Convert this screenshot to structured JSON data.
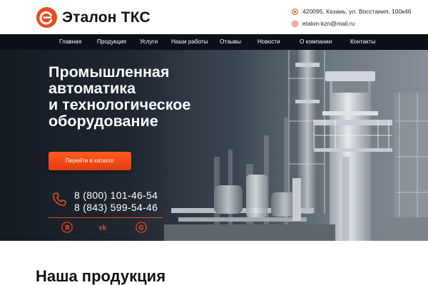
{
  "header": {
    "brand": "Эталон ТКС",
    "address": "420095, Казань, ул. Восстания, 100к46",
    "email": "etalon-kzn@mail.ru",
    "accent_color": "#e94a1c"
  },
  "nav": {
    "items": [
      {
        "label": "Главная"
      },
      {
        "label": "Продукция"
      },
      {
        "label": "Услуги"
      },
      {
        "label": "Наши работы"
      },
      {
        "label": "Отзывы"
      },
      {
        "label": "Новости"
      },
      {
        "label": "О компании"
      },
      {
        "label": "Контакты"
      }
    ]
  },
  "hero": {
    "title_lines": [
      "Промышленная",
      "автоматика",
      "и технологическое",
      "оборудование"
    ],
    "cta_label": "Перейти в каталог",
    "phones": [
      "8 (800) 101-46-54",
      "8 (843) 599-54-46"
    ],
    "socials": [
      {
        "icon": "yandex-icon"
      },
      {
        "icon": "vk-icon"
      },
      {
        "icon": "google-icon"
      }
    ]
  },
  "section": {
    "title": "Наша продукция"
  }
}
